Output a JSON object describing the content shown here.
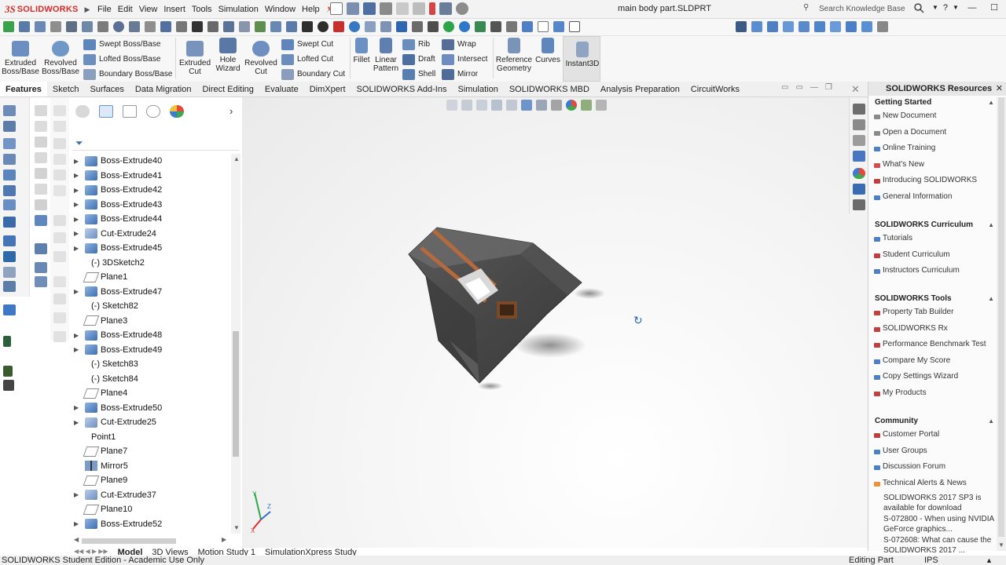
{
  "app": {
    "logo_ds": "3S",
    "logo_brand": "SOLIDWORKS",
    "document_title": "main body part.SLDPRT",
    "accent_color": "#d62b2b"
  },
  "menu": [
    "File",
    "Edit",
    "View",
    "Insert",
    "Tools",
    "Simulation",
    "Window",
    "Help"
  ],
  "search": {
    "placeholder": "Search Knowledge Base"
  },
  "ribbon": {
    "extruded_boss": "Extruded Boss/Base",
    "revolved_boss": "Revolved Boss/Base",
    "swept_boss": "Swept Boss/Base",
    "lofted_boss": "Lofted Boss/Base",
    "boundary_boss": "Boundary Boss/Base",
    "extruded_cut": "Extruded Cut",
    "hole_wizard": "Hole Wizard",
    "revolved_cut": "Revolved Cut",
    "swept_cut": "Swept Cut",
    "lofted_cut": "Lofted Cut",
    "boundary_cut": "Boundary Cut",
    "fillet": "Fillet",
    "linear_pattern": "Linear Pattern",
    "rib": "Rib",
    "draft": "Draft",
    "shell": "Shell",
    "wrap": "Wrap",
    "intersect": "Intersect",
    "mirror": "Mirror",
    "reference_geometry": "Reference Geometry",
    "curves": "Curves",
    "instant3d": "Instant3D"
  },
  "tabs": [
    "Features",
    "Sketch",
    "Surfaces",
    "Data Migration",
    "Direct Editing",
    "Evaluate",
    "DimXpert",
    "SOLIDWORKS Add-Ins",
    "Simulation",
    "SOLIDWORKS MBD",
    "Analysis Preparation",
    "CircuitWorks"
  ],
  "feature_tree": [
    {
      "label": "Boss-Extrude40",
      "type": "boss",
      "expandable": true
    },
    {
      "label": "Boss-Extrude41",
      "type": "boss",
      "expandable": true
    },
    {
      "label": "Boss-Extrude42",
      "type": "boss",
      "expandable": true
    },
    {
      "label": "Boss-Extrude43",
      "type": "boss",
      "expandable": true
    },
    {
      "label": "Boss-Extrude44",
      "type": "boss",
      "expandable": true
    },
    {
      "label": "Cut-Extrude24",
      "type": "cut",
      "expandable": true
    },
    {
      "label": "Boss-Extrude45",
      "type": "boss",
      "expandable": true
    },
    {
      "label": "(-) 3DSketch2",
      "type": "sketch",
      "expandable": false
    },
    {
      "label": "Plane1",
      "type": "plane",
      "expandable": false
    },
    {
      "label": "Boss-Extrude47",
      "type": "boss",
      "expandable": true
    },
    {
      "label": "(-) Sketch82",
      "type": "sketch",
      "expandable": false
    },
    {
      "label": "Plane3",
      "type": "plane",
      "expandable": false
    },
    {
      "label": "Boss-Extrude48",
      "type": "boss",
      "expandable": true
    },
    {
      "label": "Boss-Extrude49",
      "type": "boss",
      "expandable": true
    },
    {
      "label": "(-) Sketch83",
      "type": "sketch",
      "expandable": false
    },
    {
      "label": "(-) Sketch84",
      "type": "sketch",
      "expandable": false
    },
    {
      "label": "Plane4",
      "type": "plane",
      "expandable": false
    },
    {
      "label": "Boss-Extrude50",
      "type": "boss",
      "expandable": true
    },
    {
      "label": "Cut-Extrude25",
      "type": "cut",
      "expandable": true
    },
    {
      "label": "Point1",
      "type": "point",
      "expandable": false
    },
    {
      "label": "Plane7",
      "type": "plane",
      "expandable": false
    },
    {
      "label": "Mirror5",
      "type": "mirror",
      "expandable": false
    },
    {
      "label": "Plane9",
      "type": "plane",
      "expandable": false
    },
    {
      "label": "Cut-Extrude37",
      "type": "cut",
      "expandable": true
    },
    {
      "label": "Plane10",
      "type": "plane",
      "expandable": false
    },
    {
      "label": "Boss-Extrude52",
      "type": "boss",
      "expandable": true
    }
  ],
  "task_pane": {
    "title": "SOLIDWORKS Resources",
    "getting_started": {
      "heading": "Getting Started",
      "items": [
        "New Document",
        "Open a Document",
        "Online Training",
        "What's New",
        "Introducing SOLIDWORKS",
        "General Information"
      ]
    },
    "curriculum": {
      "heading": "SOLIDWORKS Curriculum",
      "items": [
        "Tutorials",
        "Student Curriculum",
        "Instructors Curriculum"
      ]
    },
    "tools": {
      "heading": "SOLIDWORKS Tools",
      "items": [
        "Property Tab Builder",
        "SOLIDWORKS Rx",
        "Performance Benchmark Test",
        "Compare My Score",
        "Copy Settings Wizard",
        "My Products"
      ]
    },
    "community": {
      "heading": "Community",
      "items": [
        "Customer Portal",
        "User Groups",
        "Discussion Forum",
        "Technical Alerts & News"
      ],
      "news": [
        "SOLIDWORKS 2017 SP3 is available for download",
        "S-072800 - When using NVIDIA GeForce graphics...",
        "S-072608: What can cause the SOLIDWORKS 2017 ..."
      ]
    }
  },
  "bottom_tabs": [
    "Model",
    "3D Views",
    "Motion Study 1",
    "SimulationXpress Study"
  ],
  "status": {
    "left": "SOLIDWORKS Student Edition - Academic Use Only",
    "mode": "Editing Part",
    "units": "IPS"
  }
}
